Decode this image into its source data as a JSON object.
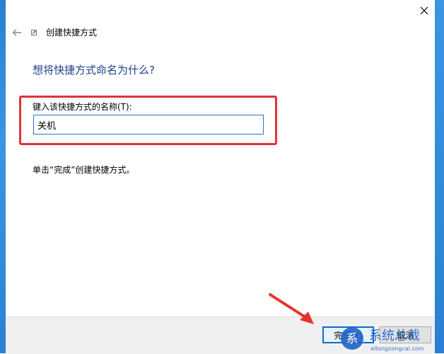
{
  "wizard": {
    "title": "创建快捷方式",
    "heading": "想将快捷方式命名为什么?",
    "name_label": "键入该快捷方式的名称(T):",
    "name_value": "关机",
    "hint": "单击“完成”创建快捷方式。",
    "finish_label": "完成(F)",
    "cancel_label": "取消"
  },
  "icons": {
    "close": "close-icon",
    "back": "back-arrow-icon",
    "shortcut": "shortcut-icon",
    "annotation": "red-arrow-icon"
  },
  "colors": {
    "heading": "#1e3f8f",
    "highlight_border": "#e0333a",
    "input_border": "#2e74c6",
    "annotation_arrow": "#e8322f"
  },
  "watermark": {
    "text": "系统总裁",
    "subtext": "xitongzongcai.com"
  }
}
